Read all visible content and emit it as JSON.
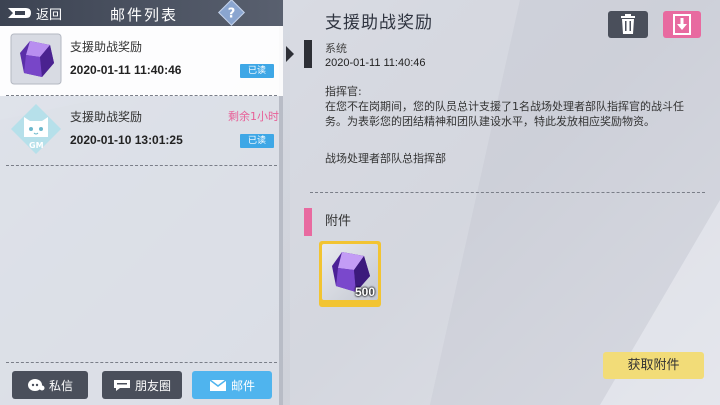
{
  "header": {
    "back_label": "返回",
    "title": "邮件列表",
    "help_icon": "question-icon",
    "help_text": "?"
  },
  "mail_list": [
    {
      "subject": "支援助战奖励",
      "date": "2020-01-11 11:40:46",
      "badge": "已读",
      "icon": "purple-crystal-icon",
      "expire": "",
      "selected": true
    },
    {
      "subject": "支援助战奖励",
      "date": "2020-01-10 13:01:25",
      "badge": "已读",
      "icon": "gm-cat-avatar-icon",
      "expire": "剩余1小时",
      "selected": false,
      "icon_text": "GM"
    }
  ],
  "bottom_tabs": [
    {
      "label": "私信",
      "icon": "chat-bubble-icon",
      "active": false
    },
    {
      "label": "朋友圈",
      "icon": "moments-icon",
      "active": false
    },
    {
      "label": "邮件",
      "icon": "envelope-icon",
      "active": true
    }
  ],
  "detail": {
    "title": "支援助战奖励",
    "sender": "系统",
    "sent_time": "2020-01-11 11:40:46",
    "body_lines": [
      "指挥官:",
      "在您不在岗期间，您的队员总计支援了1名战场处理者部队指挥官的战斗任务。为表彰您的团结精神和团队建设水平，特此发放相应奖励物资。"
    ],
    "signature": "战场处理者部队总指挥部",
    "attachment_label": "附件",
    "attachment": {
      "icon": "purple-crystal-icon",
      "quantity": "500"
    },
    "claim_label": "获取附件",
    "trash_icon": "trash-icon",
    "download_icon": "download-icon"
  },
  "colors": {
    "accent_blue": "#4fb4ee",
    "accent_pink": "#e86aa0",
    "badge_blue": "#3ea7e6",
    "gold": "#f2c432",
    "dark": "#4a4f5b"
  }
}
